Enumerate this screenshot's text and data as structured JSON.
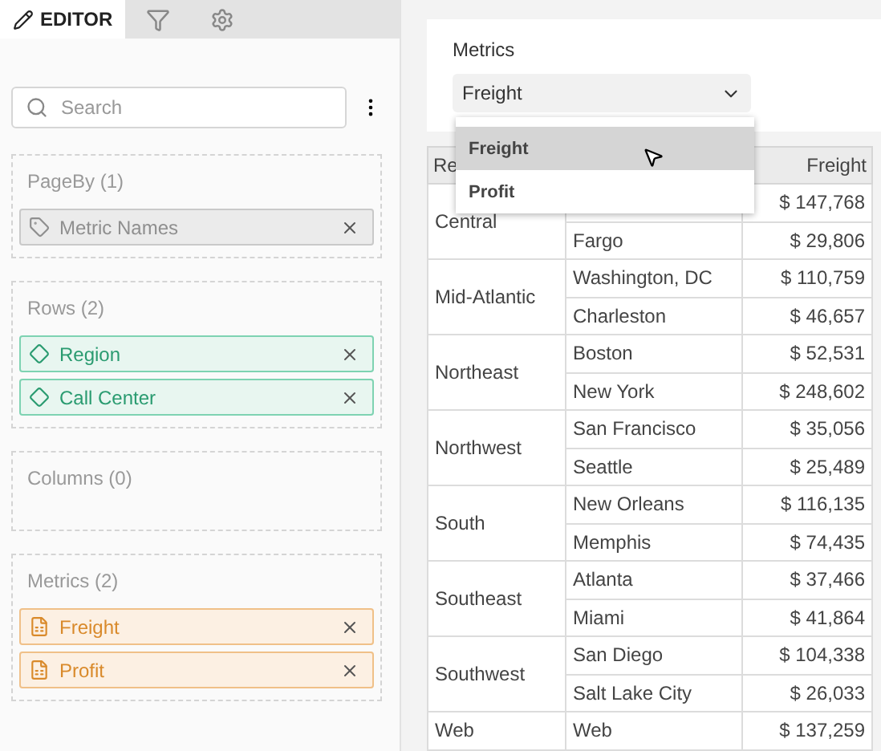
{
  "tabs": [
    {
      "kind": "editor",
      "label": "EDITOR",
      "selected": true
    },
    {
      "kind": "filter",
      "selected": false
    },
    {
      "kind": "settings",
      "selected": false
    }
  ],
  "search": {
    "placeholder": "Search"
  },
  "sections": [
    {
      "title": "PageBy (1)",
      "items": [
        {
          "kind": "attribute-names",
          "label": "Metric Names"
        }
      ]
    },
    {
      "title": "Rows (2)",
      "items": [
        {
          "kind": "attribute",
          "label": "Region"
        },
        {
          "kind": "attribute",
          "label": "Call Center"
        }
      ]
    },
    {
      "title": "Columns (0)"
    },
    {
      "title": "Metrics (2)",
      "items": [
        {
          "kind": "metric",
          "label": "Freight"
        },
        {
          "kind": "metric",
          "label": "Profit"
        }
      ]
    }
  ],
  "selector": {
    "label": "Metrics",
    "value": "Freight",
    "options": [
      {
        "label": "Freight",
        "selected": true
      },
      {
        "label": "Profit",
        "selected": false
      }
    ]
  },
  "table": {
    "columns": [
      "Re",
      "Freight"
    ],
    "groups": [
      {
        "region": "Central",
        "rows": [
          {
            "freight": "$ 147,768"
          },
          {
            "city": "Fargo",
            "freight": "$ 29,806"
          }
        ]
      },
      {
        "region": "Mid-Atlantic",
        "rows": [
          {
            "city": "Washington, DC",
            "freight": "$ 110,759"
          },
          {
            "city": "Charleston",
            "freight": "$ 46,657"
          }
        ]
      },
      {
        "region": "Northeast",
        "rows": [
          {
            "city": "Boston",
            "freight": "$ 52,531"
          },
          {
            "city": "New York",
            "freight": "$ 248,602"
          }
        ]
      },
      {
        "region": "Northwest",
        "rows": [
          {
            "city": "San Francisco",
            "freight": "$ 35,056"
          },
          {
            "city": "Seattle",
            "freight": "$ 25,489"
          }
        ]
      },
      {
        "region": "South",
        "rows": [
          {
            "city": "New Orleans",
            "freight": "$ 116,135"
          },
          {
            "city": "Memphis",
            "freight": "$ 74,435"
          }
        ]
      },
      {
        "region": "Southeast",
        "rows": [
          {
            "city": "Atlanta",
            "freight": "$ 37,466"
          },
          {
            "city": "Miami",
            "freight": "$ 41,864"
          }
        ]
      },
      {
        "region": "Southwest",
        "rows": [
          {
            "city": "San Diego",
            "freight": "$ 104,338"
          },
          {
            "city": "Salt Lake City",
            "freight": "$ 26,033"
          }
        ]
      },
      {
        "region": "Web",
        "rows": [
          {
            "city": "Web",
            "freight": "$ 137,259"
          }
        ]
      }
    ]
  }
}
